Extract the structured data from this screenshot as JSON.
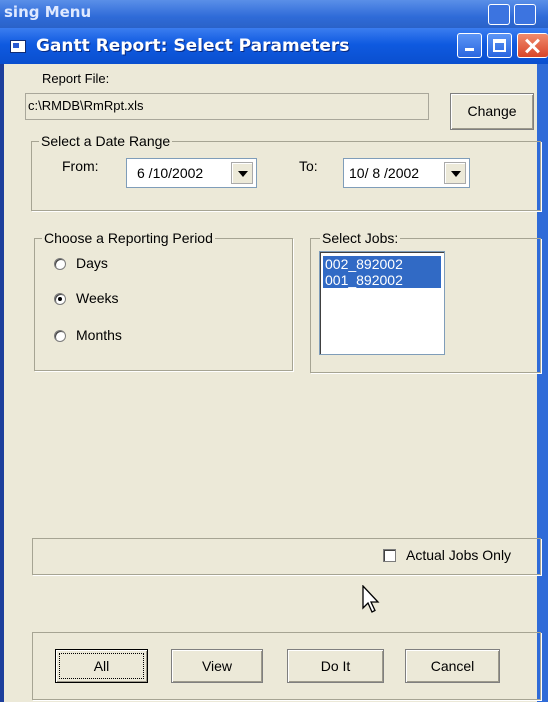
{
  "background_window": {
    "title": "sing Menu"
  },
  "dialog": {
    "title": "Gantt Report: Select Parameters",
    "report_file": {
      "label": "Report File:",
      "value": "c:\\RMDB\\RmRpt.xls",
      "change_button": "Change"
    },
    "date_range": {
      "legend": "Select a Date Range",
      "from_label": "From:",
      "from_value": "6 /10/2002",
      "to_label": "To:",
      "to_value": "10/ 8 /2002"
    },
    "reporting_period": {
      "legend": "Choose a Reporting Period",
      "options": [
        {
          "label": "Days",
          "checked": false
        },
        {
          "label": "Weeks",
          "checked": true
        },
        {
          "label": "Months",
          "checked": false
        }
      ]
    },
    "select_jobs": {
      "legend": "Select Jobs:",
      "items": [
        {
          "label": "002_892002",
          "selected": true
        },
        {
          "label": "001_892002",
          "selected": true
        }
      ]
    },
    "actual_jobs_only": {
      "label": "Actual Jobs Only",
      "checked": false
    },
    "buttons": {
      "all": "All",
      "view": "View",
      "do_it": "Do It",
      "cancel": "Cancel"
    }
  },
  "colors": {
    "title_bar": "#0a4fcf",
    "selection": "#316ac5",
    "dialog_bg": "#ece9d8"
  }
}
